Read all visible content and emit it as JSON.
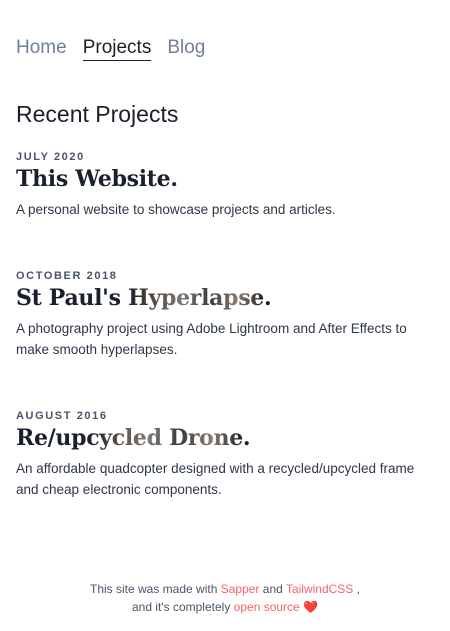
{
  "nav": {
    "items": [
      {
        "label": "Home"
      },
      {
        "label": "Projects"
      },
      {
        "label": "Blog"
      }
    ]
  },
  "main": {
    "section_title": "Recent Projects",
    "projects": [
      {
        "date": "JULY 2020",
        "title": "This Website.",
        "description": "A personal website to showcase projects and articles."
      },
      {
        "date": "OCTOBER 2018",
        "title_pre": "St Paul's ",
        "title_hl": "Hyperlapse",
        "title_post": ".",
        "description": "A photography project using Adobe Lightroom and After Effects to make smooth hyperlapses."
      },
      {
        "date": "AUGUST 2016",
        "title_pre": "Re/up",
        "title_hl": "cycled Drone",
        "title_post": ".",
        "description": "An affordable quadcopter designed with a recycled/upcycled frame and cheap electronic components."
      }
    ]
  },
  "footer": {
    "line1_text": "This site was made with",
    "sapper": "Sapper",
    "and": "and",
    "tailwind": "TailwindCSS",
    "comma": ",",
    "line2_text": "and it's completely",
    "open_source": "open source",
    "heart": "❤️"
  },
  "colors": {
    "accent_link": "#f56565",
    "text_dark": "#1a202c",
    "text_muted": "#718096"
  }
}
